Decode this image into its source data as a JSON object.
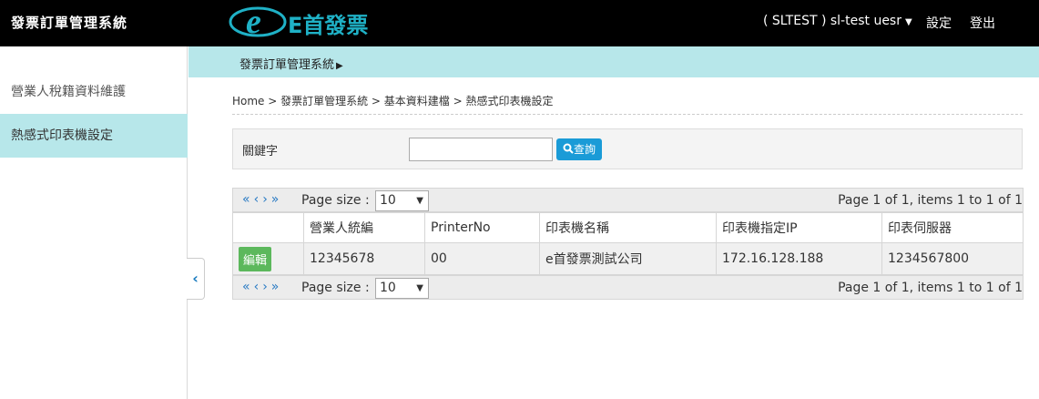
{
  "header": {
    "app_title": "發票訂單管理系統",
    "logo_text": "E首發票",
    "user_label": "( SLTEST ) sl-test uesr",
    "settings_label": "設定",
    "logout_label": "登出"
  },
  "sidebar": {
    "items": [
      {
        "label": "營業人稅籍資料維護"
      },
      {
        "label": "熱感式印表機設定"
      }
    ]
  },
  "subheader": {
    "title": "發票訂單管理系統"
  },
  "breadcrumb": {
    "text": "Home > 發票訂單管理系統 > 基本資料建檔 > 熱感式印表機設定"
  },
  "search": {
    "label": "關鍵字",
    "value": "",
    "button_label": "查詢"
  },
  "grid": {
    "page_size_label": "Page size :",
    "page_size_value": "10",
    "page_info": "Page 1 of 1, items 1 to 1 of 1",
    "columns": [
      "",
      "營業人統編",
      "PrinterNo",
      "印表機名稱",
      "印表機指定IP",
      "印表伺服器"
    ],
    "rows": [
      {
        "action": "編輯",
        "tax_id": "12345678",
        "printer_no": "00",
        "printer_name": "e首發票測試公司",
        "ip": "172.16.128.188",
        "server": "1234567800"
      }
    ]
  },
  "colors": {
    "topbar": "#000000",
    "accent": "#b7e7ea",
    "brand": "#1fb1c6",
    "search_button": "#1a9bd7",
    "edit_button": "#5cb85c"
  }
}
